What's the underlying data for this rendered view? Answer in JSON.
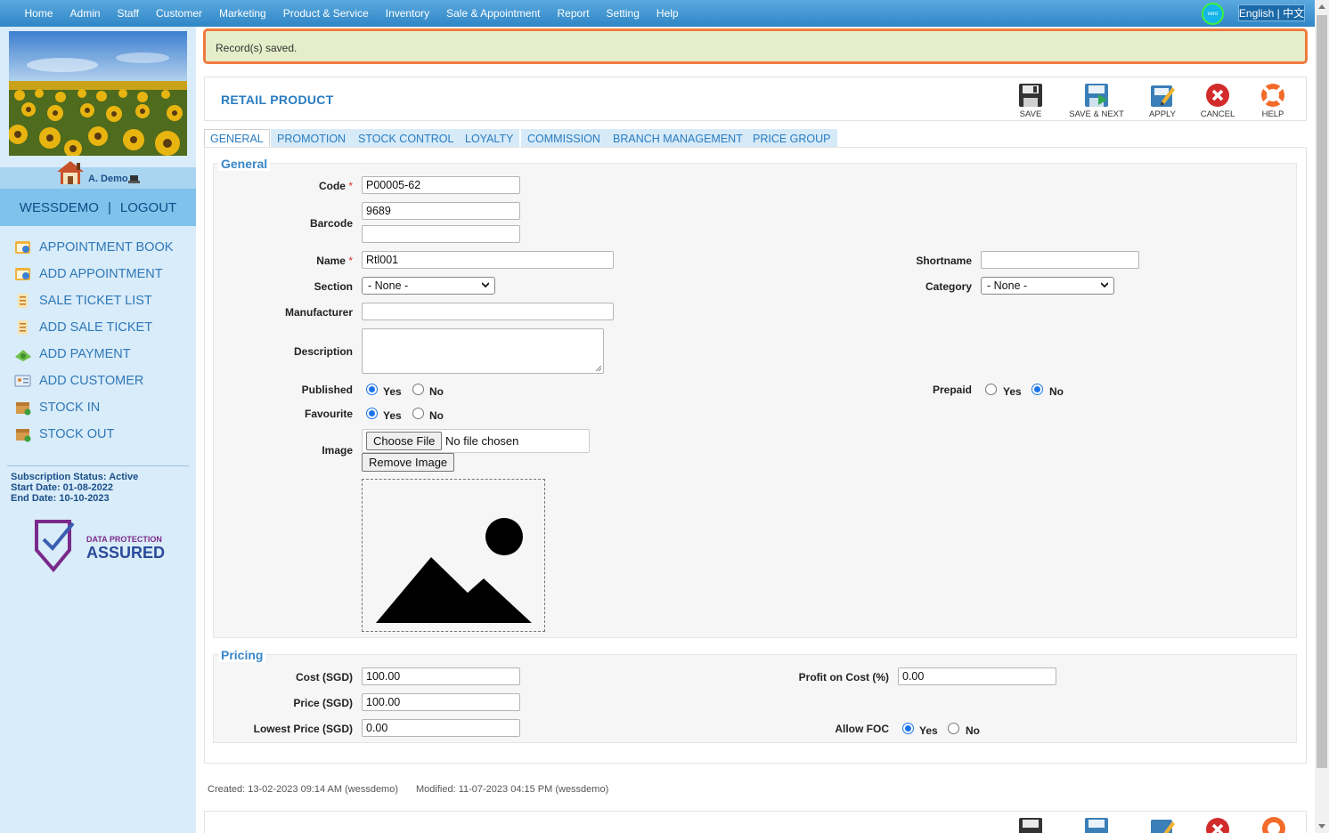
{
  "topnav": {
    "items": [
      "Home",
      "Admin",
      "Staff",
      "Customer",
      "Marketing",
      "Product & Service",
      "Inventory",
      "Sale & Appointment",
      "Report",
      "Setting",
      "Help"
    ],
    "xero_label": "xero",
    "language": "English | 中文"
  },
  "sidebar": {
    "user": "A. Demo",
    "account": "WESSDEMO",
    "separator": "|",
    "logout": "LOGOUT",
    "menu": [
      {
        "label": "APPOINTMENT BOOK",
        "icon": "calendar-icon"
      },
      {
        "label": "ADD APPOINTMENT",
        "icon": "calendar-add-icon"
      },
      {
        "label": "SALE TICKET LIST",
        "icon": "ticket-list-icon"
      },
      {
        "label": "ADD SALE TICKET",
        "icon": "ticket-add-icon"
      },
      {
        "label": "ADD PAYMENT",
        "icon": "money-icon"
      },
      {
        "label": "ADD CUSTOMER",
        "icon": "customer-card-icon"
      },
      {
        "label": "STOCK IN",
        "icon": "box-in-icon"
      },
      {
        "label": "STOCK OUT",
        "icon": "box-out-icon"
      }
    ],
    "subscription_status": "Subscription Status: Active",
    "start_date": "Start Date: 01-08-2022",
    "end_date": "End Date: 10-10-2023",
    "badge_line1": "DATA PROTECTION",
    "badge_line2": "ASSURED"
  },
  "notice": "Record(s) saved.",
  "header": {
    "title": "RETAIL PRODUCT",
    "tools": {
      "save": "SAVE",
      "save_next": "SAVE & NEXT",
      "apply": "APPLY",
      "cancel": "CANCEL",
      "help": "HELP"
    }
  },
  "tabs": [
    "GENERAL",
    "PROMOTION",
    "STOCK CONTROL",
    "LOYALTY",
    "COMMISSION",
    "BRANCH MANAGEMENT",
    "PRICE GROUP"
  ],
  "general": {
    "legend": "General",
    "code_label": "Code",
    "code": "P00005-62",
    "barcode_label": "Barcode",
    "barcode1": "9689",
    "barcode2": "",
    "name_label": "Name",
    "name": "Rtl001",
    "shortname_label": "Shortname",
    "shortname": "",
    "section_label": "Section",
    "section": "- None -",
    "category_label": "Category",
    "category": "- None -",
    "manufacturer_label": "Manufacturer",
    "manufacturer": "",
    "description_label": "Description",
    "published_label": "Published",
    "published": "Yes",
    "prepaid_label": "Prepaid",
    "prepaid": "No",
    "favourite_label": "Favourite",
    "favourite": "Yes",
    "yes": "Yes",
    "no": "No",
    "required_mark": "*",
    "image_label": "Image",
    "choose_file": "Choose File",
    "no_file": "No file chosen",
    "remove_image": "Remove Image"
  },
  "pricing": {
    "legend": "Pricing",
    "cost_label": "Cost (SGD)",
    "cost": "100.00",
    "price_label": "Price (SGD)",
    "price": "100.00",
    "lowest_label": "Lowest Price (SGD)",
    "lowest": "0.00",
    "profit_label": "Profit on Cost (%)",
    "profit": "0.00",
    "foc_label": "Allow FOC",
    "foc": "Yes"
  },
  "meta": {
    "created": "Created: 13-02-2023 09:14 AM (wessdemo)",
    "modified": "Modified: 11-07-2023 04:15 PM (wessdemo)"
  }
}
